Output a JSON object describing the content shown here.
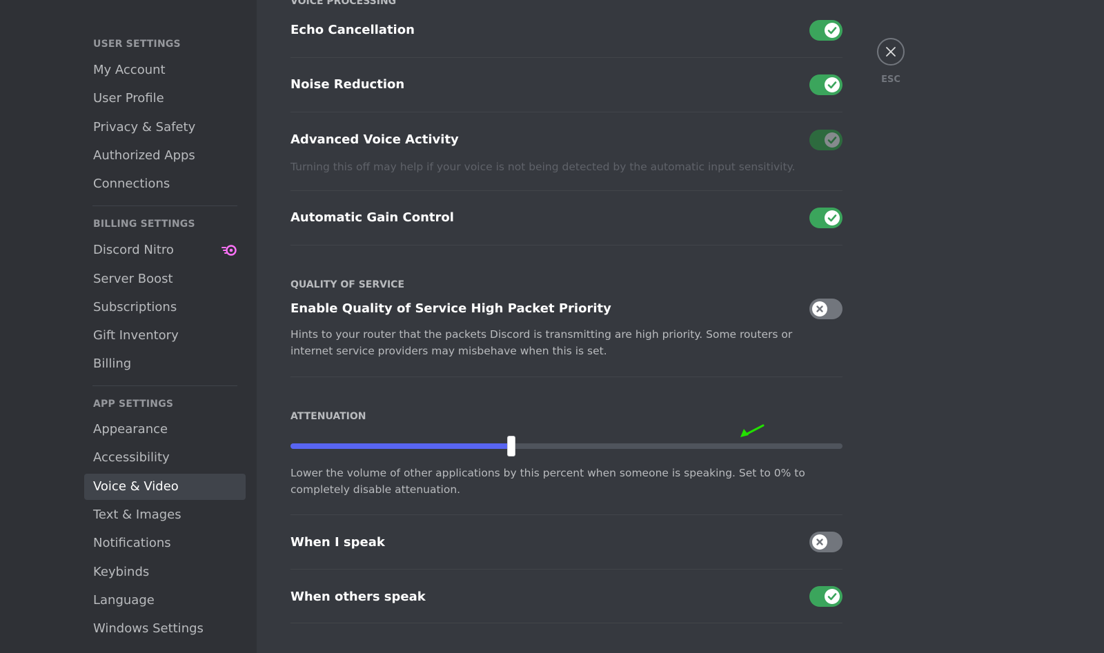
{
  "sidebar": {
    "user_settings_header": "USER SETTINGS",
    "user_items": [
      "My Account",
      "User Profile",
      "Privacy & Safety",
      "Authorized Apps",
      "Connections"
    ],
    "billing_settings_header": "BILLING SETTINGS",
    "billing_items": [
      "Discord Nitro",
      "Server Boost",
      "Subscriptions",
      "Gift Inventory",
      "Billing"
    ],
    "app_settings_header": "APP SETTINGS",
    "app_items": [
      "Appearance",
      "Accessibility",
      "Voice & Video",
      "Text & Images",
      "Notifications",
      "Keybinds",
      "Language",
      "Windows Settings"
    ],
    "selected_item": "Voice & Video"
  },
  "voice_processing": {
    "header": "VOICE PROCESSING",
    "echo_cancellation": {
      "label": "Echo Cancellation",
      "enabled": true
    },
    "noise_reduction": {
      "label": "Noise Reduction",
      "enabled": true
    },
    "advanced_voice_activity": {
      "label": "Advanced Voice Activity",
      "description": "Turning this off may help if your voice is not being detected by the automatic input sensitivity.",
      "enabled": true,
      "disabled_state": true
    },
    "automatic_gain_control": {
      "label": "Automatic Gain Control",
      "enabled": true
    }
  },
  "quality_of_service": {
    "header": "QUALITY OF SERVICE",
    "label": "Enable Quality of Service High Packet Priority",
    "description": "Hints to your router that the packets Discord is transmitting are high priority. Some routers or internet service providers may misbehave when this is set.",
    "enabled": false
  },
  "attenuation": {
    "header": "ATTENUATION",
    "value_fraction": 0.4,
    "description": "Lower the volume of other applications by this percent when someone is speaking. Set to 0% to completely disable attenuation.",
    "when_i_speak": {
      "label": "When I speak",
      "enabled": false
    },
    "when_others_speak": {
      "label": "When others speak",
      "enabled": true
    }
  },
  "close": {
    "esc_label": "ESC"
  },
  "colors": {
    "toggle_on": "#3ba55c",
    "toggle_off": "#72767d",
    "slider_fill": "#5865f2",
    "annotation_arrow": "#22e000",
    "nitro_icon": "#ff73fa"
  }
}
